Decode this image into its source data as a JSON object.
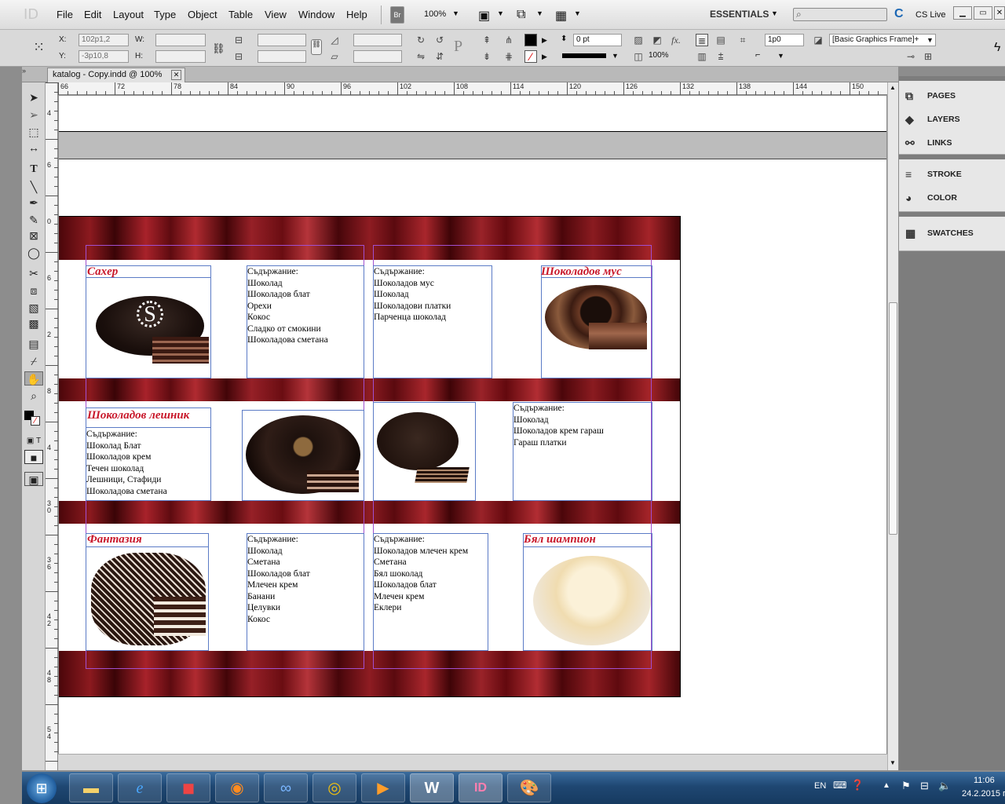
{
  "menubar": {
    "app_logo": "ID",
    "items": [
      "File",
      "Edit",
      "Layout",
      "Type",
      "Object",
      "Table",
      "View",
      "Window",
      "Help"
    ],
    "bridge": "Br",
    "zoom": "100%",
    "workspace": "ESSENTIALS",
    "cs_live": "CS Live"
  },
  "control": {
    "x_label": "X:",
    "x_value": "102p1,2",
    "y_label": "Y:",
    "y_value": "-3p10,8",
    "w_label": "W:",
    "h_label": "H:",
    "stroke_weight": "0 pt",
    "opacity": "100%",
    "frame_offset": "1p0",
    "object_style": "[Basic Graphics Frame]+"
  },
  "document": {
    "tab_title": "katalog - Copy.indd @ 100%",
    "ruler_marks": [
      "66",
      "72",
      "78",
      "84",
      "90",
      "96",
      "102",
      "108",
      "114",
      "120",
      "126",
      "132",
      "138",
      "144",
      "150"
    ],
    "vruler_marks": [
      "4",
      "6",
      "0",
      "6",
      "2",
      "8",
      "4",
      "3 0",
      "3 6",
      "4 2",
      "4 8",
      "5 4"
    ]
  },
  "panels": {
    "group1": [
      "PAGES",
      "LAYERS",
      "LINKS"
    ],
    "group2": [
      "STROKE",
      "COLOR"
    ],
    "group3": [
      "SWATCHES"
    ]
  },
  "catalog": {
    "contents_label": "Съдържание:",
    "items": [
      {
        "title": "Сахер",
        "ingredients": [
          "Шоколад",
          "Шоколадов блат",
          "Орехи",
          "Кокос",
          "Сладко от смокини",
          "Шоколадова сметана"
        ]
      },
      {
        "title": "Шоколадов мус",
        "ingredients": [
          "Шоколадов мус",
          "Шоколад",
          "Шоколадови платки",
          "Парченца шоколад"
        ]
      },
      {
        "title": "Шоколадов лешник",
        "ingredients": [
          "Шоколад Блат",
          "Шоколадов крем",
          "Течен шоколад",
          "Лешници, Стафиди",
          "Шоколадова сметана"
        ]
      },
      {
        "title": "",
        "ingredients": [
          "Шоколад",
          "Шоколадов крем гараш",
          "Гараш платки"
        ]
      },
      {
        "title": "Фантазия",
        "ingredients": [
          "Шоколад",
          "Сметана",
          "Шоколадов блат",
          "Млечен крем",
          "Банани",
          "Целувки",
          "Кокос"
        ]
      },
      {
        "title": "Бял шампион",
        "ingredients": [
          "Шоколадов млечен крем",
          "Сметана",
          "Бял шоколад",
          "Шоколадов блат",
          "Млечен крем",
          "Еклери"
        ]
      }
    ]
  },
  "taskbar": {
    "lang": "EN",
    "time": "11:06",
    "date": "24.2.2015 г."
  }
}
